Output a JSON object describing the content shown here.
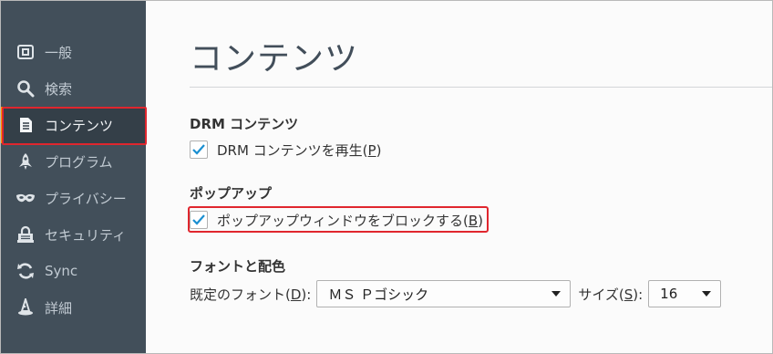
{
  "sidebar": {
    "items": [
      {
        "id": "general",
        "label": "一般",
        "icon": "general-icon"
      },
      {
        "id": "search",
        "label": "検索",
        "icon": "search-icon"
      },
      {
        "id": "content",
        "label": "コンテンツ",
        "icon": "document-icon",
        "selected": true
      },
      {
        "id": "applications",
        "label": "プログラム",
        "icon": "rocket-icon"
      },
      {
        "id": "privacy",
        "label": "プライバシー",
        "icon": "mask-icon"
      },
      {
        "id": "security",
        "label": "セキュリティ",
        "icon": "lock-icon"
      },
      {
        "id": "sync",
        "label": "Sync",
        "icon": "sync-icon"
      },
      {
        "id": "advanced",
        "label": "詳細",
        "icon": "wizard-icon"
      }
    ]
  },
  "main": {
    "title": "コンテンツ",
    "drm": {
      "heading": "DRM コンテンツ",
      "checkbox_label_pre": "DRM コンテンツを再生(",
      "checkbox_accesskey": "P",
      "checkbox_label_post": ")",
      "checked": true
    },
    "popup": {
      "heading": "ポップアップ",
      "checkbox_label_pre": "ポップアップウィンドウをブロックする(",
      "checkbox_accesskey": "B",
      "checkbox_label_post": ")",
      "checked": true
    },
    "fonts": {
      "heading": "フォントと配色",
      "default_font_label_pre": "既定のフォント(",
      "default_font_accesskey": "D",
      "default_font_label_post": "):",
      "default_font_value": "ＭＳ Ｐゴシック",
      "size_label_pre": "サイズ(",
      "size_accesskey": "S",
      "size_label_post": "):",
      "size_value": "16"
    }
  },
  "colors": {
    "sidebar_bg": "#424f5a",
    "selected_bg": "#343f48",
    "selected_accent": "#ff9500",
    "highlight": "#e0262e",
    "check": "#1a8fd1"
  }
}
